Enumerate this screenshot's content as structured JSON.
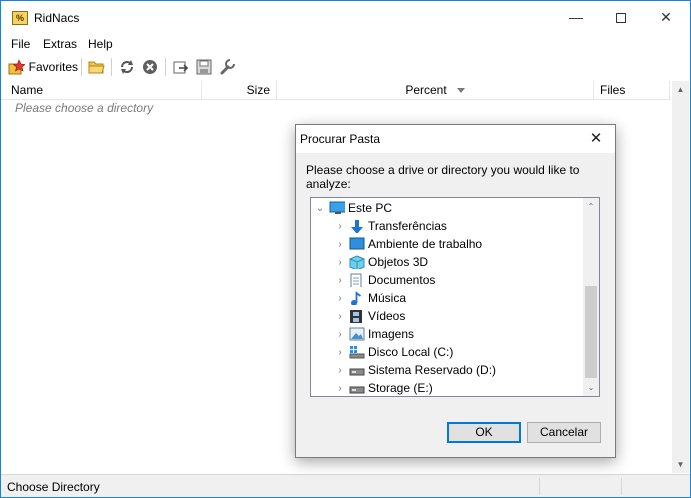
{
  "window": {
    "title": "RidNacs",
    "app_icon_glyph": "%",
    "controls": {
      "minimize": "—",
      "close": "✕"
    }
  },
  "menu": [
    "File",
    "Extras",
    "Help"
  ],
  "toolbar": {
    "favorites_label": "Favorites",
    "icons": [
      "favorites-icon",
      "open-folder-icon",
      "refresh-icon",
      "stop-icon",
      "export-icon",
      "save-icon",
      "settings-wrench-icon"
    ]
  },
  "columns": {
    "name": "Name",
    "size": "Size",
    "percent": "Percent",
    "files": "Files"
  },
  "list": {
    "placeholder": "Please choose a directory"
  },
  "status": {
    "text": "Choose Directory"
  },
  "dialog": {
    "title": "Procurar Pasta",
    "prompt": "Please choose a drive or directory you would like to analyze:",
    "root": "Este PC",
    "items": [
      {
        "label": "Transferências",
        "icon": "download-arrow-icon"
      },
      {
        "label": "Ambiente de trabalho",
        "icon": "desktop-icon"
      },
      {
        "label": "Objetos 3D",
        "icon": "cube-3d-icon"
      },
      {
        "label": "Documentos",
        "icon": "document-icon"
      },
      {
        "label": "Música",
        "icon": "music-note-icon"
      },
      {
        "label": "Vídeos",
        "icon": "film-icon"
      },
      {
        "label": "Imagens",
        "icon": "pictures-icon"
      },
      {
        "label": "Disco Local (C:)",
        "icon": "windows-drive-icon"
      },
      {
        "label": "Sistema Reservado (D:)",
        "icon": "drive-icon"
      },
      {
        "label": "Storage (E:)",
        "icon": "drive-icon"
      }
    ],
    "ok": "OK",
    "cancel": "Cancelar"
  },
  "colors": {
    "accent": "#0078d7",
    "window_border": "#1883d7",
    "dialog_bg": "#f0f0f0"
  }
}
